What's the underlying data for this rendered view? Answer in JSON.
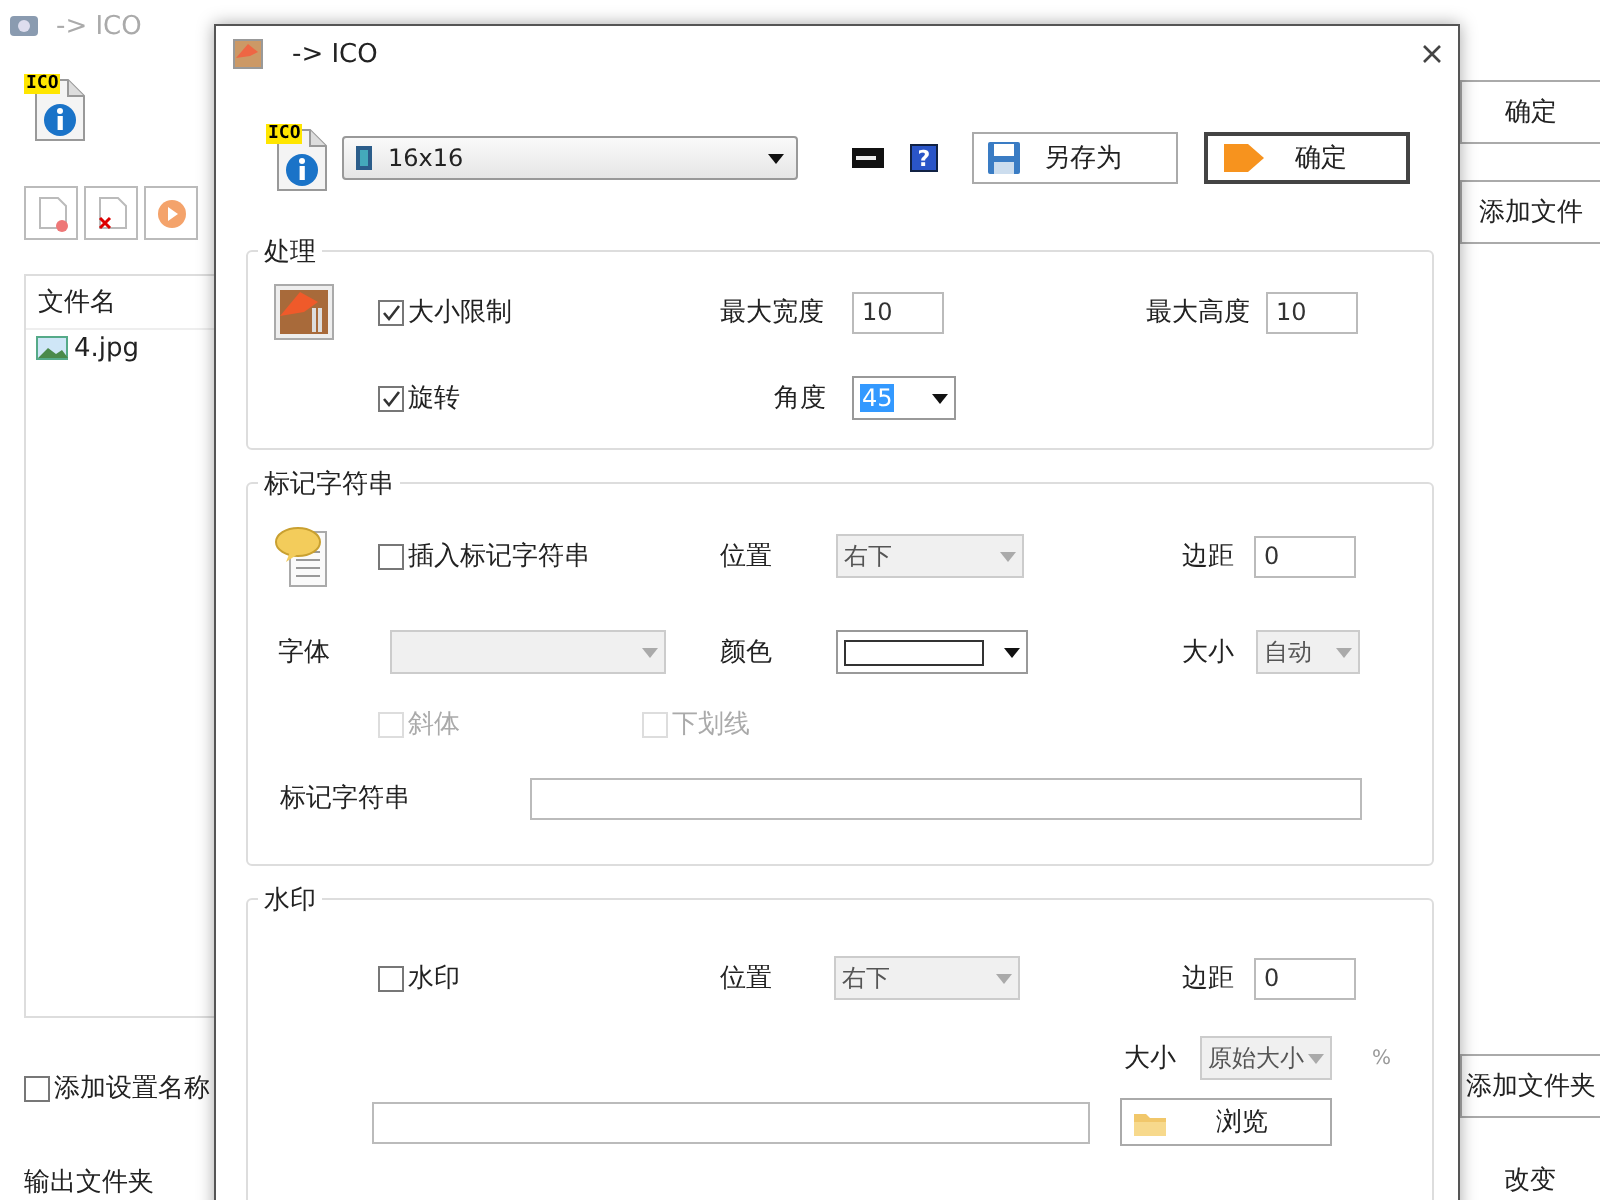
{
  "background_window": {
    "title": "-> ICO",
    "badge": "ICO",
    "file_list": {
      "columns": [
        "文件名"
      ],
      "rows": [
        {
          "name": "4.jpg"
        }
      ]
    },
    "right_buttons": [
      "确定",
      "添加文件"
    ],
    "bottom_buttons": [
      "添加文件夹",
      "改变"
    ],
    "add_setting_name": {
      "label": "添加设置名称",
      "checked": false
    },
    "output_folder_label": "输出文件夹"
  },
  "dialog": {
    "title": "-> ICO",
    "badge": "ICO",
    "size_select": "16x16",
    "help": "?",
    "buttons": [
      {
        "label": "另存为",
        "kind": "save",
        "default": false
      },
      {
        "label": "确定",
        "kind": "ok",
        "default": true
      }
    ],
    "processing": {
      "title": "处理",
      "size_limit": {
        "label": "大小限制",
        "checked": true
      },
      "max_width": {
        "label": "最大宽度",
        "value": "10"
      },
      "max_height": {
        "label": "最大高度",
        "value": "10"
      },
      "rotate": {
        "label": "旋转",
        "checked": true
      },
      "angle": {
        "label": "角度",
        "value": "45"
      }
    },
    "marker": {
      "title": "标记字符串",
      "insert": {
        "label": "插入标记字符串",
        "checked": false
      },
      "position": {
        "label": "位置",
        "value": "右下",
        "disabled": true
      },
      "margin": {
        "label": "边距",
        "value": "0"
      },
      "font": {
        "label": "字体",
        "disabled": true
      },
      "color": {
        "label": "颜色"
      },
      "size": {
        "label": "大小",
        "value": "自动",
        "disabled": true
      },
      "italic": {
        "label": "斜体",
        "checked": false,
        "disabled": true
      },
      "underline": {
        "label": "下划线",
        "checked": false,
        "disabled": true
      },
      "text": {
        "label": "标记字符串"
      }
    },
    "watermark": {
      "title": "水印",
      "enabled": {
        "label": "水印",
        "checked": false
      },
      "position": {
        "label": "位置",
        "value": "右下",
        "disabled": true
      },
      "margin": {
        "label": "边距",
        "value": "0"
      },
      "size": {
        "label": "大小",
        "value": "原始大小",
        "disabled": true,
        "unit": "%"
      },
      "browse_button": "浏览"
    }
  }
}
